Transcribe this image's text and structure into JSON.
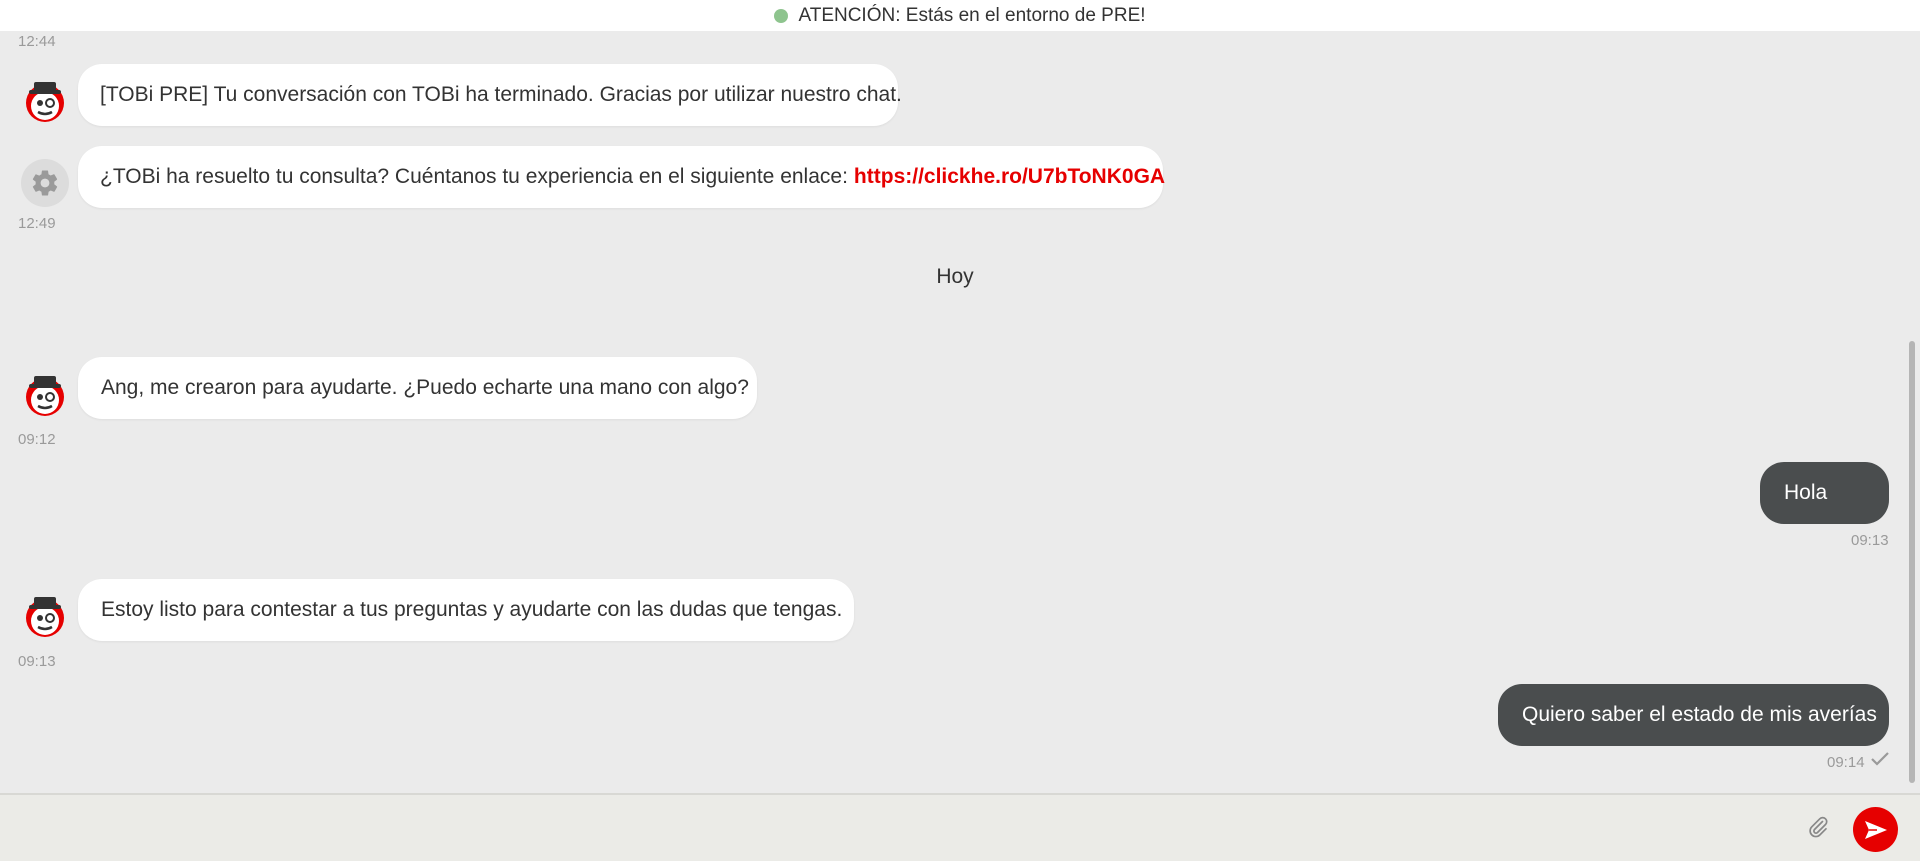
{
  "banner": {
    "text": "ATENCIÓN: Estás en el entorno de PRE!",
    "dot_color": "#8ec48e"
  },
  "colors": {
    "accent": "#e60000",
    "user_bubble": "#4a4d4e",
    "bot_bubble": "#ffffff",
    "background": "#ebebeb"
  },
  "messages": [
    {
      "sender": "bot",
      "avatar": "tobi-avatar-icon",
      "text": "[TOBi PRE] Tu conversación con TOBi ha terminado. Gracias por utilizar nuestro chat.",
      "time_before": "12:44"
    },
    {
      "sender": "system",
      "avatar": "gear-icon",
      "text": "¿TOBi ha resuelto tu consulta? Cuéntanos tu experiencia en el siguiente enlace:",
      "link": "https://clickhe.ro/U7bToNK0GA",
      "time": "12:49"
    },
    {
      "sender": "bot",
      "avatar": "tobi-avatar-icon",
      "text": "Ang, me crearon para ayudarte. ¿Puedo echarte una mano con algo?",
      "time": "09:12"
    },
    {
      "sender": "user",
      "text": "Hola",
      "time": "09:13"
    },
    {
      "sender": "bot",
      "avatar": "tobi-avatar-icon",
      "text": "Estoy listo para contestar a tus preguntas y ayudarte con las dudas que tengas.",
      "time": "09:13"
    },
    {
      "sender": "user",
      "text": "Quiero saber el estado de mis averías",
      "time": "09:14",
      "status": "check-icon"
    }
  ],
  "day_divider": "Hoy",
  "input": {
    "attach_icon": "paperclip-icon",
    "send_icon": "send-icon"
  }
}
